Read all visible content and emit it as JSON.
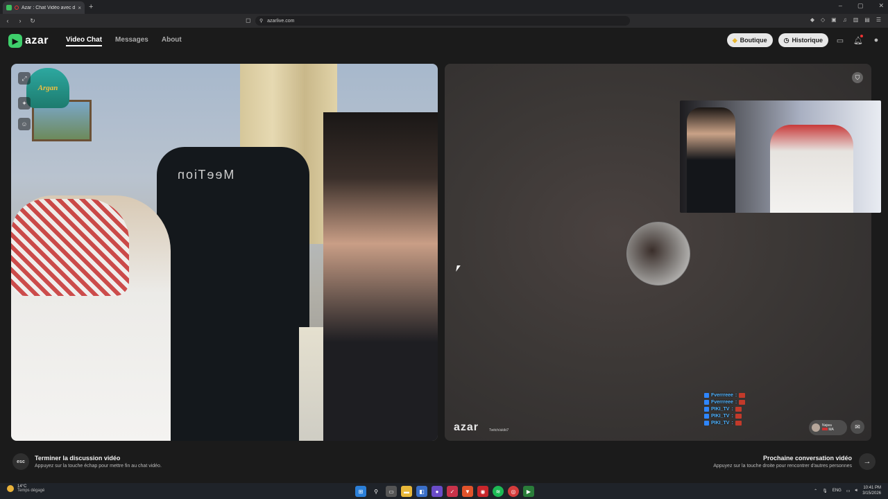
{
  "browser": {
    "tab_title": "Azar : Chat Vidéo avec de no",
    "tab_close": "×",
    "new_tab": "+",
    "url": "azarlive.com",
    "back": "‹",
    "forward": "›",
    "reload": "↻",
    "win_min": "–",
    "win_max": "▢",
    "win_close": "✕"
  },
  "header": {
    "logo_text": "azar",
    "nav": [
      "Video Chat",
      "Messages",
      "About"
    ],
    "boutique_label": "Boutique",
    "history_label": "Historique"
  },
  "left_pane": {
    "overlay_logo_text": "Argan",
    "chair_brand": "MeeTion"
  },
  "right_pane": {
    "watermark": "azar",
    "watermark_sub": "Twitch/akiki7",
    "peer_name": "Najwa",
    "peer_country": "MA",
    "chat_messages": [
      {
        "user": "Fverrreee",
        "text": ":"
      },
      {
        "user": "Fverrreee",
        "text": ":"
      },
      {
        "user": "PIKI_TV",
        "text": ":"
      },
      {
        "user": "PIKI_TV",
        "text": ":"
      },
      {
        "user": "PIKI_TV",
        "text": ":"
      }
    ]
  },
  "footer": {
    "esc_key": "esc",
    "end_title": "Terminer la discussion vidéo",
    "end_sub": "Appuyez sur la touche échap pour mettre fin au chat vidéo.",
    "next_title": "Prochaine conversation vidéo",
    "next_sub": "Appuyez sur la touche droite pour rencontrer d'autres personnes",
    "next_icon": "→"
  },
  "taskbar": {
    "temperature": "14°C",
    "condition": "Temps dégagé",
    "language": "ENG",
    "time": "10:41 PM",
    "date": "3/15/2026"
  },
  "colors": {
    "accent": "#3ecf6b",
    "chat_name": "#4fb3ff"
  }
}
